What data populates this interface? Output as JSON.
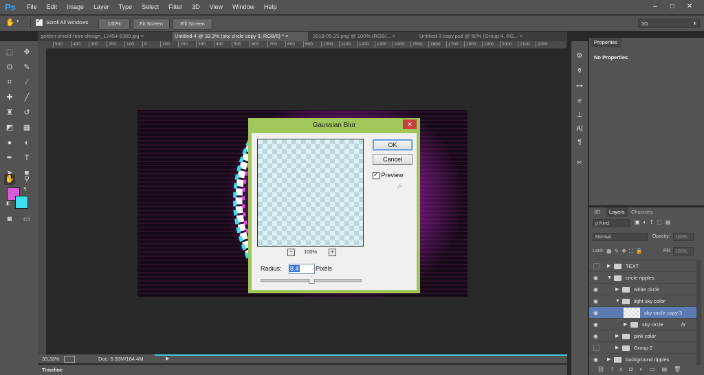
{
  "app": {
    "logo": "Ps"
  },
  "menu": [
    "File",
    "Edit",
    "Image",
    "Layer",
    "Type",
    "Select",
    "Filter",
    "3D",
    "View",
    "Window",
    "Help"
  ],
  "window_controls": {
    "minimize": "–",
    "maximize": "□",
    "close": "✕"
  },
  "options_bar": {
    "scroll_all_windows": "Scroll All Windows",
    "zoom_100": "100%",
    "fit_screen": "Fit Screen",
    "fill_screen": "Fill Screen",
    "workspace": "3D"
  },
  "tabs": [
    {
      "label": "golden-shield-retro-design_12454-5380.jpg",
      "close": "×"
    },
    {
      "label": "Untitled-4 @ 33.3% (sky circle copy 3, RGB/8) *",
      "close": "×"
    },
    {
      "label": "2019-05-25.png @ 100% (RGB/...",
      "close": "×"
    },
    {
      "label": "Untitled-3 copy.psd @ 50% (Group 4, RG...",
      "close": "×"
    }
  ],
  "ruler_h": [
    "500",
    "400",
    "300",
    "200",
    "100",
    "0",
    "100",
    "200",
    "300",
    "400",
    "500",
    "600",
    "700",
    "800",
    "900",
    "1000",
    "1100",
    "1200",
    "1300",
    "1400",
    "1500",
    "1600",
    "1700",
    "1800",
    "1900",
    "2000",
    "2100",
    "2200"
  ],
  "dialog": {
    "title": "Gaussian Blur",
    "close": "✕",
    "ok": "OK",
    "cancel": "Cancel",
    "preview_label": "Preview",
    "preview_checked": true,
    "zoom": "100%",
    "zoom_out": "−",
    "zoom_in": "+",
    "radius_label": "Radius:",
    "radius_value": "8.4",
    "pixels_label": "Pixels",
    "slider_position": 0.5
  },
  "properties": {
    "tab": "Properties",
    "message": "No Properties"
  },
  "layers_panel": {
    "tabs": [
      "3D",
      "Layers",
      "Channels"
    ],
    "kind": "ρ Kind",
    "blend_mode": "Normal",
    "opacity_label": "Opacity:",
    "opacity_value": "100%",
    "lock_label": "Lock:",
    "fill_label": "Fill:",
    "fill_value": "100%",
    "layers": [
      {
        "name": "TEXT",
        "visible": false,
        "type": "folder",
        "expanded": false,
        "indent": 0
      },
      {
        "name": "cricle ripples",
        "visible": true,
        "type": "folder",
        "expanded": true,
        "indent": 0
      },
      {
        "name": "white circle",
        "visible": true,
        "type": "folder",
        "expanded": false,
        "indent": 1
      },
      {
        "name": "light sky color",
        "visible": true,
        "type": "folder",
        "expanded": true,
        "indent": 1
      },
      {
        "name": "sky circle copy 3",
        "visible": true,
        "type": "layer",
        "selected": true,
        "indent": 2
      },
      {
        "name": "sky circle",
        "visible": true,
        "type": "folder",
        "expanded": false,
        "indent": 2,
        "fx": "fx"
      },
      {
        "name": "pink color",
        "visible": true,
        "type": "folder",
        "expanded": false,
        "indent": 1
      },
      {
        "name": "Group 2",
        "visible": false,
        "type": "folder",
        "expanded": false,
        "indent": 1
      },
      {
        "name": "background ripples",
        "visible": true,
        "type": "folder",
        "expanded": false,
        "indent": 0
      }
    ]
  },
  "status": {
    "zoom": "33.33%",
    "doc": "Doc: 5.93M/164.4M"
  },
  "timeline": {
    "label": "Timeline"
  },
  "colors": {
    "foreground": "#d65bd9",
    "background": "#3de0f0",
    "dialog_frame": "#a1c75a",
    "selection": "#5c7bb4"
  }
}
